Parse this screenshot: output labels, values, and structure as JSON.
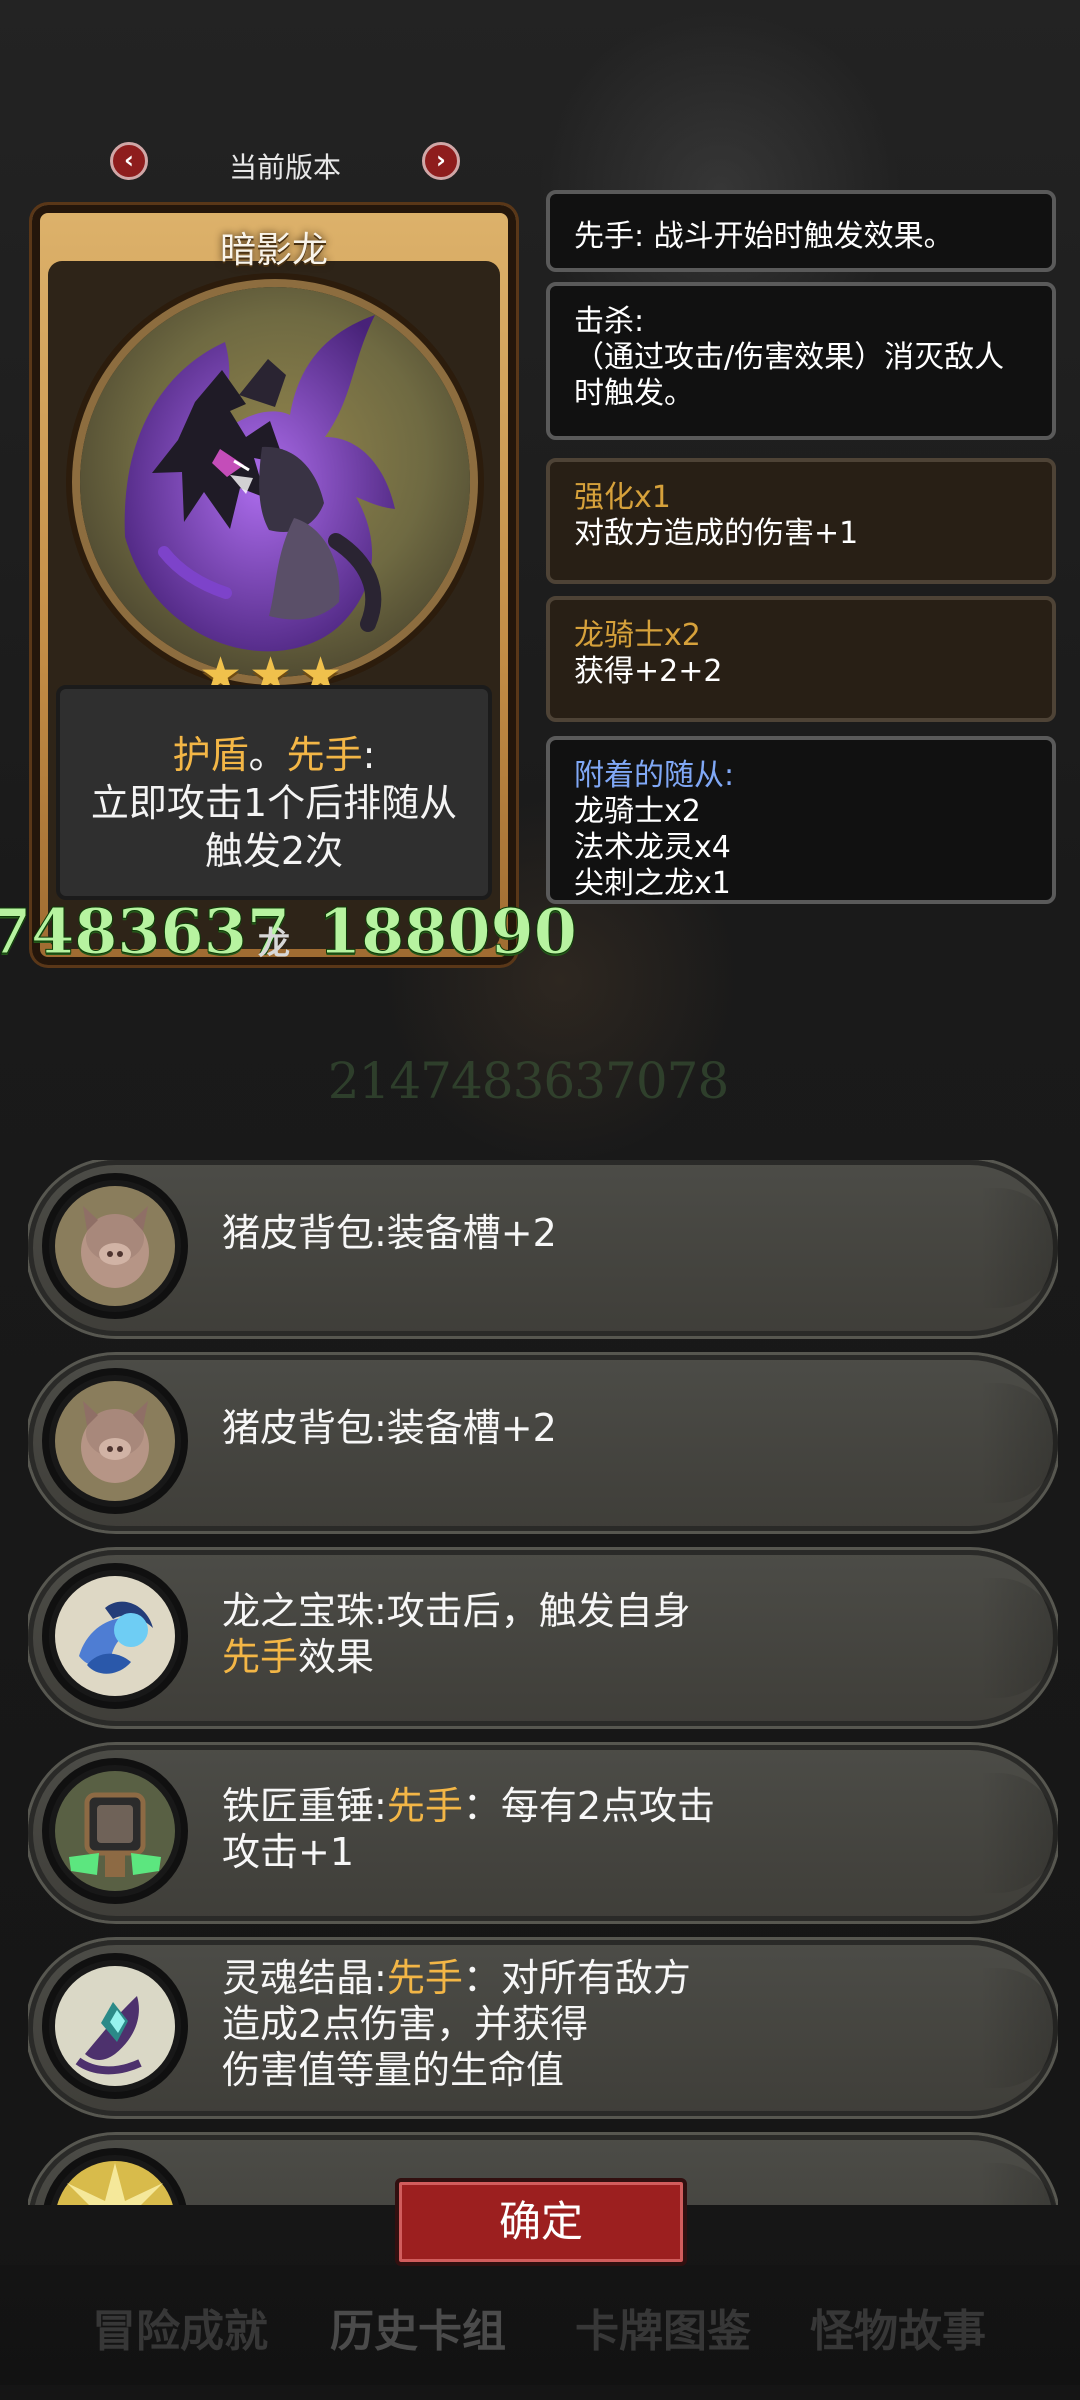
{
  "version_switcher": {
    "label": "当前版本",
    "prev_icon": "chevron-left-icon",
    "next_icon": "chevron-right-icon"
  },
  "card": {
    "name": "暗影龙",
    "star_count": 3,
    "desc": {
      "line1_keyword_a": "护盾",
      "line1_separator": "。",
      "line1_keyword_b": "先手",
      "line1_suffix": ":",
      "line2": "立即攻击1个后排随从",
      "line3": "触发2次"
    },
    "left_stat": "7483637",
    "tribe": "龙",
    "right_stat": "188090",
    "faded_number": "2147483637078"
  },
  "details": {
    "box1": "先手: 战斗开始时触发效果。",
    "box2": {
      "title": "击杀:",
      "body": "（通过攻击/伤害效果）消灭敌人时触发。"
    },
    "box3": {
      "title": "强化x1",
      "body": "对敌方造成的伤害+1"
    },
    "box4": {
      "title": "龙骑士x2",
      "body": "获得+2+2"
    },
    "box5": {
      "title": "附着的随从:",
      "lines": [
        "龙骑士x2",
        "法术龙灵x4",
        "尖刺之龙x1"
      ]
    }
  },
  "items": [
    {
      "icon": "pig-backpack-icon",
      "text": "猪皮背包:装备槽+2"
    },
    {
      "icon": "pig-backpack-icon",
      "text": "猪皮背包:装备槽+2"
    },
    {
      "icon": "dragon-orb-icon",
      "prefix": "龙之宝珠:攻击后，触发自身",
      "keyword": "先手",
      "suffix": "效果"
    },
    {
      "icon": "blacksmith-hammer-icon",
      "prefix": "铁匠重锤:",
      "keyword": "先手",
      "suffix": "：每有2点攻击",
      "line2": "攻击+1"
    },
    {
      "icon": "soul-crystal-icon",
      "prefix": "灵魂结晶:",
      "keyword": "先手",
      "suffix": "：对所有敌方",
      "line2": "造成2点伤害，并获得",
      "line3": "伤害值等量的生命值"
    },
    {
      "icon": "gold-burst-icon",
      "text": ""
    }
  ],
  "confirm_button": "确定",
  "tabs": [
    "冒险成就",
    "历史卡组",
    "卡牌图鉴",
    "怪物故事"
  ],
  "colors": {
    "accent_gold": "#f3b646",
    "stat_green": "#b7f3a0",
    "button_red": "#9c1f1f",
    "title_blue": "#80a8f6"
  }
}
